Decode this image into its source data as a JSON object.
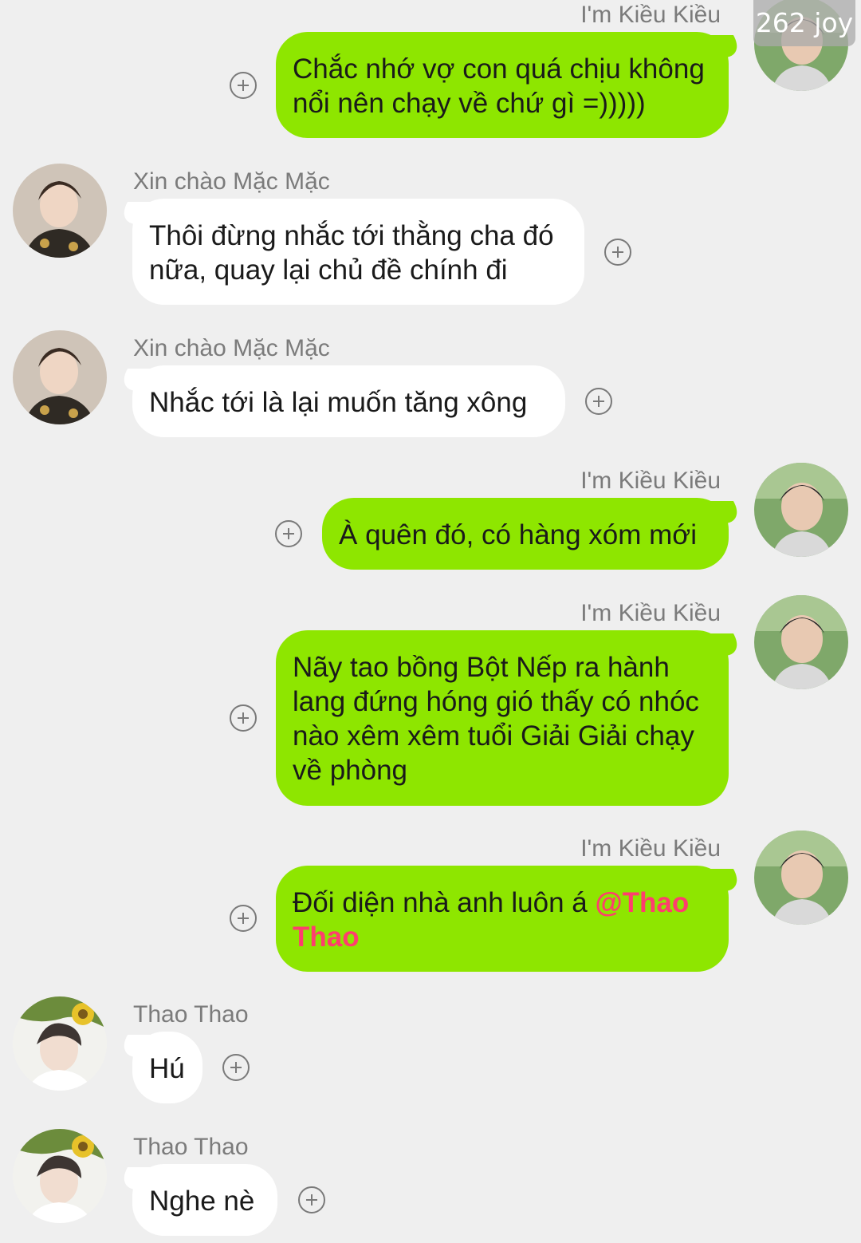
{
  "watermark": "262 joy",
  "participants": {
    "kieu": {
      "name": "I'm Kiều Kiều"
    },
    "mac": {
      "name": "Xin chào Mặc Mặc"
    },
    "thao": {
      "name": "Thao Thao"
    }
  },
  "messages": [
    {
      "sender": "I'm Kiều Kiều",
      "direction": "outgoing",
      "text": "Chắc nhớ vợ con quá chịu không nổi nên chạy về chứ gì =)))))"
    },
    {
      "sender": "Xin chào Mặc Mặc",
      "direction": "incoming",
      "text": "Thôi đừng nhắc tới thằng cha đó nữa, quay lại chủ đề chính đi"
    },
    {
      "sender": "Xin chào Mặc Mặc",
      "direction": "incoming",
      "text": "Nhắc tới là lại muốn tăng xông"
    },
    {
      "sender": "I'm Kiều Kiều",
      "direction": "outgoing",
      "text": "À quên đó, có hàng xóm mới"
    },
    {
      "sender": "I'm Kiều Kiều",
      "direction": "outgoing",
      "text": "Nãy tao bồng Bột Nếp ra hành lang đứng hóng gió thấy có nhóc nào xêm xêm tuổi Giải Giải chạy về phòng"
    },
    {
      "sender": "I'm Kiều Kiều",
      "direction": "outgoing",
      "text": "Đối diện nhà anh luôn á ",
      "mention": "@Thao Thao"
    },
    {
      "sender": "Thao Thao",
      "direction": "incoming",
      "text": "Hú"
    },
    {
      "sender": "Thao Thao",
      "direction": "incoming",
      "text": "Nghe nè"
    }
  ],
  "colors": {
    "background": "#efefef",
    "outgoing_bubble": "#8ee600",
    "incoming_bubble": "#ffffff",
    "mention": "#ff3d6e",
    "name_text": "#7b7b7b"
  },
  "icons": {
    "react": "plus-circle-icon"
  }
}
